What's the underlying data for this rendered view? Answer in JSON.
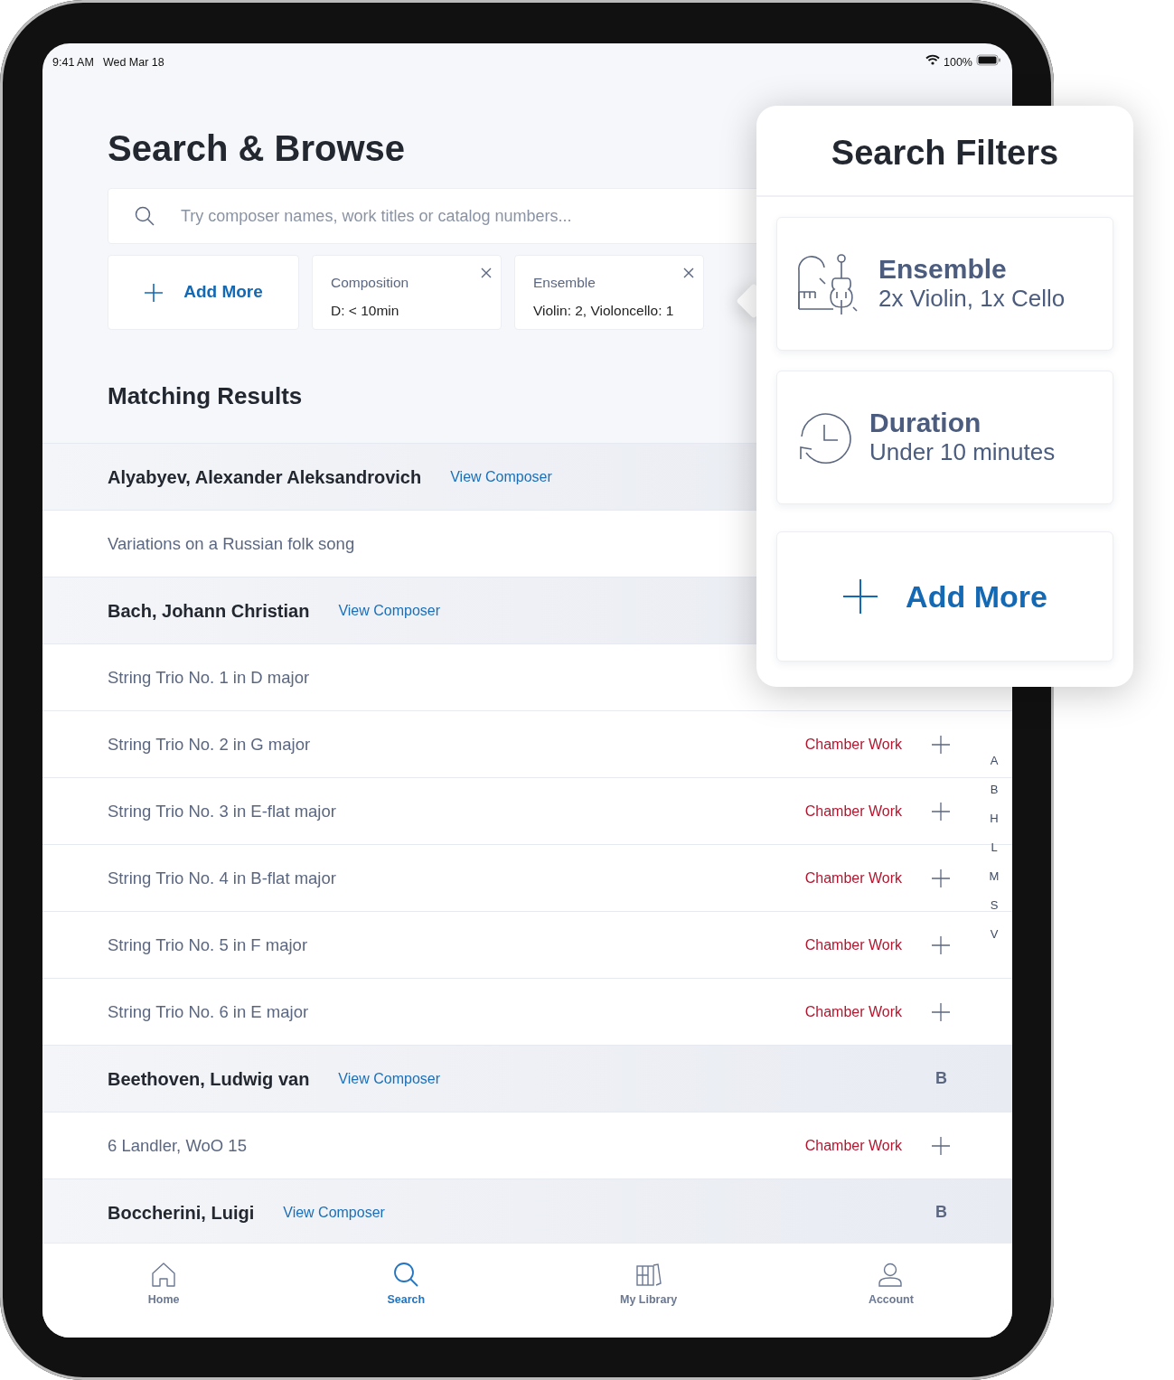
{
  "status_bar": {
    "time": "9:41 AM",
    "date": "Wed Mar 18",
    "battery": "100%"
  },
  "title": "Search & Browse",
  "search": {
    "placeholder": "Try composer names, work titles or catalog numbers..."
  },
  "filter_chips": [
    {
      "kind": "add",
      "label": "Add More"
    },
    {
      "kind": "filter",
      "label": "Composition",
      "value": "D: < 10min"
    },
    {
      "kind": "filter",
      "label": "Ensemble",
      "value": "Violin: 2, Violoncello: 1"
    }
  ],
  "results_heading": "Matching Results",
  "results": [
    {
      "kind": "composer",
      "name": "Alyabyev, Alexander Aleksandrovich",
      "link": "View Composer"
    },
    {
      "kind": "work",
      "title": "Variations on a Russian folk song"
    },
    {
      "kind": "composer",
      "name": "Bach, Johann Christian",
      "link": "View Composer"
    },
    {
      "kind": "work",
      "title": "String Trio No. 1 in D major"
    },
    {
      "kind": "work",
      "title": "String Trio No. 2 in G major",
      "category": "Chamber Work"
    },
    {
      "kind": "work",
      "title": "String Trio No. 3 in E-flat major",
      "category": "Chamber Work"
    },
    {
      "kind": "work",
      "title": "String Trio No. 4 in B-flat major",
      "category": "Chamber Work"
    },
    {
      "kind": "work",
      "title": "String Trio No. 5 in F major",
      "category": "Chamber Work"
    },
    {
      "kind": "work",
      "title": "String Trio No. 6 in E major",
      "category": "Chamber Work"
    },
    {
      "kind": "composer",
      "name": "Beethoven, Ludwig van",
      "link": "View Composer",
      "letter": "B"
    },
    {
      "kind": "work",
      "title": "6 Landler, WoO 15",
      "category": "Chamber Work"
    },
    {
      "kind": "composer",
      "name": "Boccherini, Luigi",
      "link": "View Composer",
      "letter": "B"
    }
  ],
  "index_letters": [
    "A",
    "B",
    "H",
    "L",
    "M",
    "S",
    "V"
  ],
  "tabs": [
    {
      "kind": "home",
      "label": "Home",
      "selected": false
    },
    {
      "kind": "search",
      "label": "Search",
      "selected": true
    },
    {
      "kind": "library",
      "label": "My Library",
      "selected": false
    },
    {
      "kind": "account",
      "label": "Account",
      "selected": false
    }
  ],
  "popover": {
    "title": "Search Filters",
    "filters": [
      {
        "kind": "ensemble",
        "label": "Ensemble",
        "value": "2x Violin, 1x Cello"
      },
      {
        "kind": "duration",
        "label": "Duration",
        "value": "Under 10 minutes"
      }
    ],
    "add_label": "Add More"
  }
}
